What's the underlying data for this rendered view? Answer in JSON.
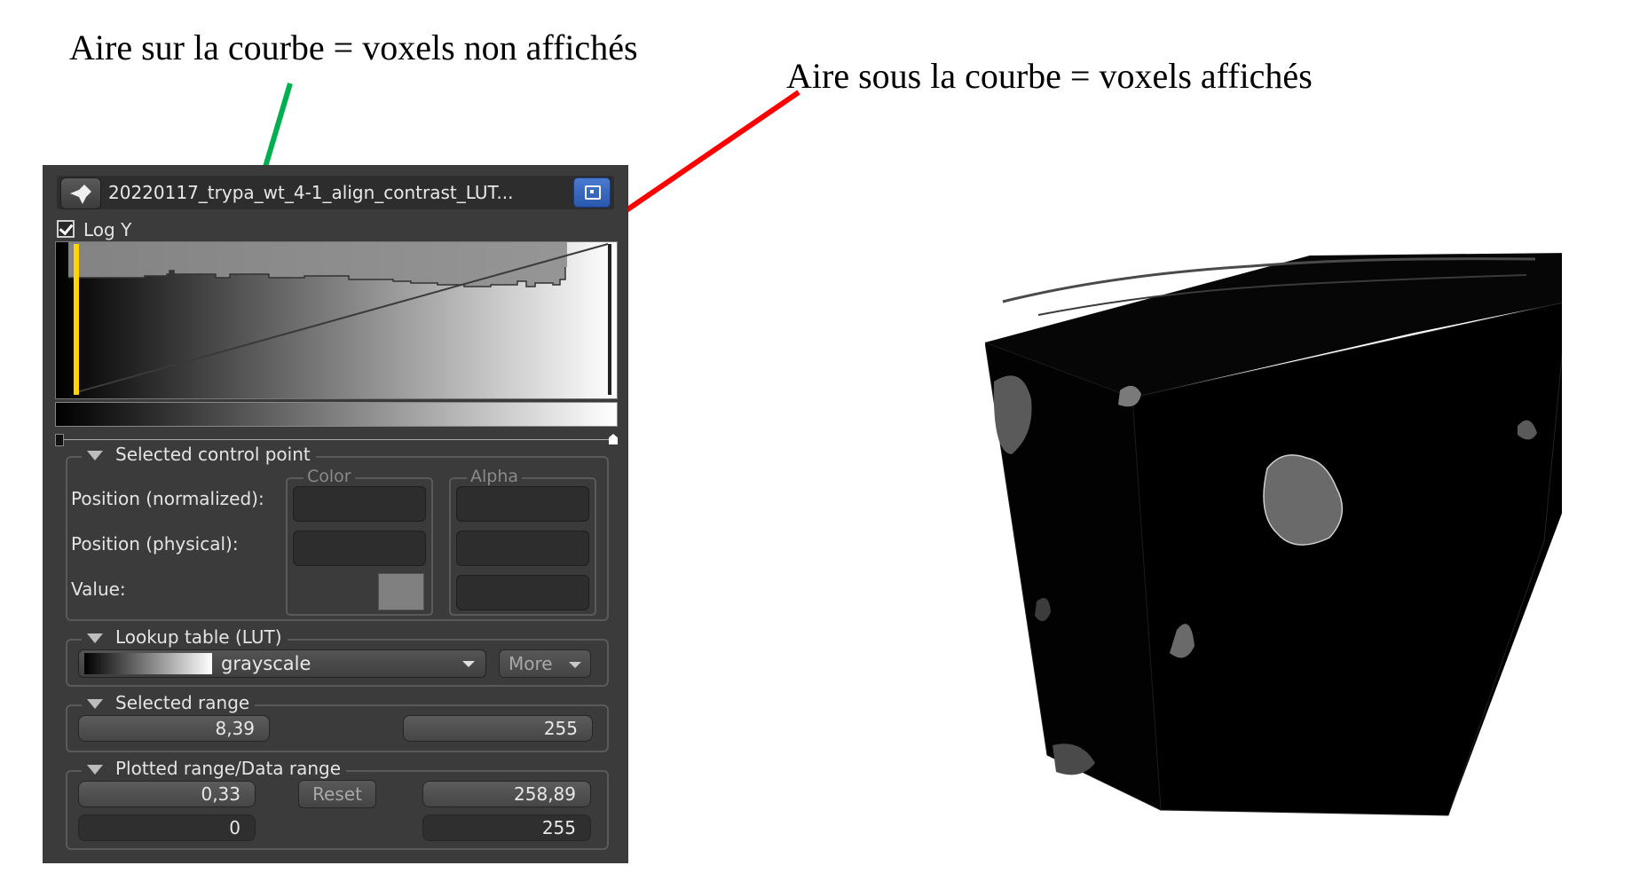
{
  "annotations": {
    "green": "Aire sur la courbe = voxels non affichés",
    "red": "Aire sous la courbe = voxels affichés"
  },
  "panel": {
    "title": "20220117_trypa_wt_4-1_align_contrast_LUT...",
    "log_y_label": "Log Y",
    "log_y_checked": true,
    "control_point": {
      "heading": "Selected control point",
      "color_label": "Color",
      "alpha_label": "Alpha",
      "position_normalized_label": "Position (normalized):",
      "position_physical_label": "Position (physical):",
      "value_label": "Value:",
      "swatch_color": "#808080"
    },
    "lut": {
      "heading": "Lookup table (LUT)",
      "selected": "grayscale",
      "more_label": "More"
    },
    "selected_range": {
      "heading": "Selected range",
      "min": "8,39",
      "max": "255"
    },
    "plotted_range": {
      "heading": "Plotted range/Data range",
      "plot_min": "0,33",
      "plot_max": "258,89",
      "reset_label": "Reset",
      "data_min": "0",
      "data_max": "255"
    }
  },
  "colors": {
    "green_arrow": "#00b050",
    "red_arrow": "#ff0000",
    "threshold_marker": "#ffd400",
    "panel_bg": "#3b3b3b"
  },
  "icons": {
    "pin": "pin-icon",
    "float": "float-window-icon",
    "collapse": "triangle-down-icon",
    "dropdown": "chevron-down-icon"
  }
}
